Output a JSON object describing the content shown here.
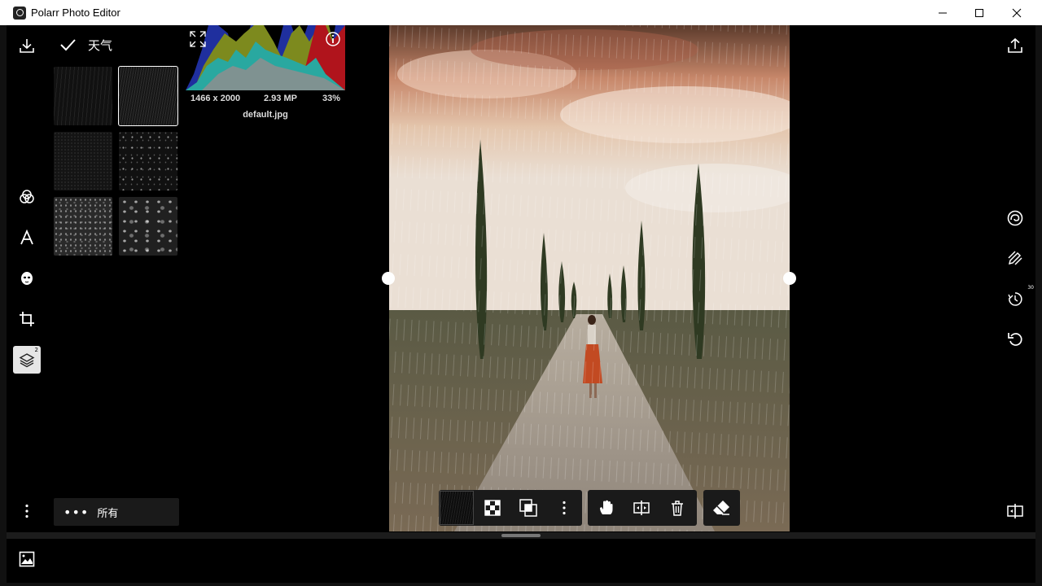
{
  "window": {
    "title": "Polarr Photo Editor",
    "controls": [
      "minimize",
      "maximize",
      "close"
    ]
  },
  "left_toolbar": {
    "top_tool": "download-icon",
    "tools": [
      {
        "name": "color-circles-icon"
      },
      {
        "name": "text-icon"
      },
      {
        "name": "face-icon"
      },
      {
        "name": "crop-icon"
      },
      {
        "name": "layers-icon",
        "active": true,
        "badge": "2"
      }
    ],
    "more": "more-vertical-icon"
  },
  "panel": {
    "title": "天气",
    "filter_label": "所有",
    "thumbnails": [
      {
        "kind": "rain-light",
        "selected": false
      },
      {
        "kind": "rain-dark",
        "selected": true
      },
      {
        "kind": "dust-fine",
        "selected": false
      },
      {
        "kind": "stars-sparse",
        "selected": false
      },
      {
        "kind": "snow-dense",
        "selected": false
      },
      {
        "kind": "snow-bokeh",
        "selected": false
      }
    ]
  },
  "image_info": {
    "dimensions": "1466 x 2000",
    "megapixels": "2.93 MP",
    "zoom": "33%",
    "filename": "default.jpg"
  },
  "canvas_toolbar": {
    "group1": [
      "layer-thumbnail",
      "checker-icon",
      "blend-icon",
      "more-vertical-icon"
    ],
    "group2": [
      "hand-icon",
      "compare-icon",
      "trash-icon"
    ],
    "group3": [
      "eraser-icon"
    ]
  },
  "right_toolbar": {
    "top": "share-icon",
    "tools": [
      "spiral-icon",
      "pen-slash-icon",
      "timer-icon",
      "undo-icon"
    ],
    "timer_badge": "30",
    "bottom": "compare-icon"
  },
  "colors": {
    "background": "#000000",
    "panel_bg": "#1a1a1a",
    "active_tool": "#e6e6e6"
  }
}
